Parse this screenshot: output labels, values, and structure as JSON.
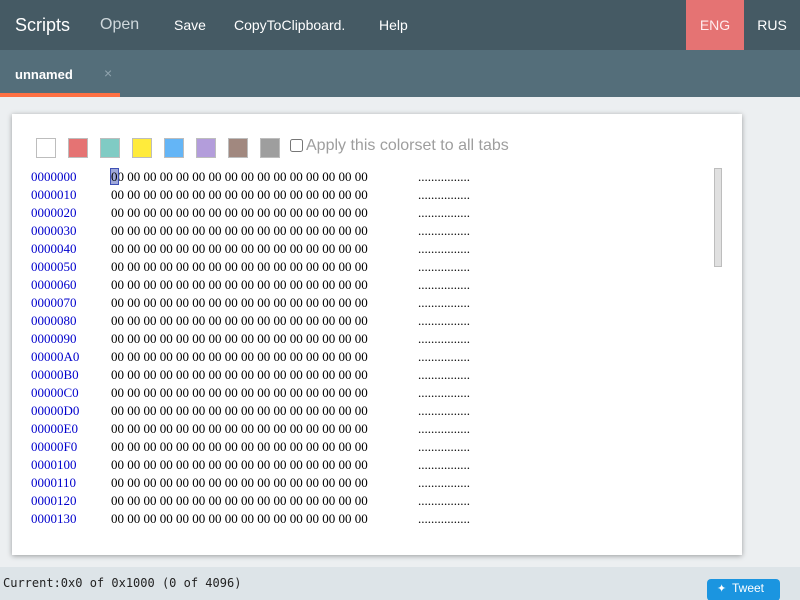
{
  "header": {
    "brand": "Scripts",
    "nav": {
      "open": "Open",
      "save": "Save",
      "copy": "CopyToClipboard.",
      "help": "Help"
    },
    "languages": [
      "ENG",
      "RUS"
    ],
    "active_language": "ENG"
  },
  "tab": {
    "label": "unnamed",
    "close": "×"
  },
  "colorset": {
    "swatches": [
      "#ffffff",
      "#e57373",
      "#80cbc4",
      "#ffeb3b",
      "#64b5f6",
      "#b39ddb",
      "#a1887f",
      "#9e9e9e"
    ],
    "apply_label": "Apply this colorset to all tabs"
  },
  "hex": {
    "rows": [
      {
        "addr": "0000000",
        "bytes": "00 00 00 00 00 00 00 00 00 00 00 00 00 00 00 00",
        "ascii": "................"
      },
      {
        "addr": "0000010",
        "bytes": "00 00 00 00 00 00 00 00 00 00 00 00 00 00 00 00",
        "ascii": "................"
      },
      {
        "addr": "0000020",
        "bytes": "00 00 00 00 00 00 00 00 00 00 00 00 00 00 00 00",
        "ascii": "................"
      },
      {
        "addr": "0000030",
        "bytes": "00 00 00 00 00 00 00 00 00 00 00 00 00 00 00 00",
        "ascii": "................"
      },
      {
        "addr": "0000040",
        "bytes": "00 00 00 00 00 00 00 00 00 00 00 00 00 00 00 00",
        "ascii": "................"
      },
      {
        "addr": "0000050",
        "bytes": "00 00 00 00 00 00 00 00 00 00 00 00 00 00 00 00",
        "ascii": "................"
      },
      {
        "addr": "0000060",
        "bytes": "00 00 00 00 00 00 00 00 00 00 00 00 00 00 00 00",
        "ascii": "................"
      },
      {
        "addr": "0000070",
        "bytes": "00 00 00 00 00 00 00 00 00 00 00 00 00 00 00 00",
        "ascii": "................"
      },
      {
        "addr": "0000080",
        "bytes": "00 00 00 00 00 00 00 00 00 00 00 00 00 00 00 00",
        "ascii": "................"
      },
      {
        "addr": "0000090",
        "bytes": "00 00 00 00 00 00 00 00 00 00 00 00 00 00 00 00",
        "ascii": "................"
      },
      {
        "addr": "00000A0",
        "bytes": "00 00 00 00 00 00 00 00 00 00 00 00 00 00 00 00",
        "ascii": "................"
      },
      {
        "addr": "00000B0",
        "bytes": "00 00 00 00 00 00 00 00 00 00 00 00 00 00 00 00",
        "ascii": "................"
      },
      {
        "addr": "00000C0",
        "bytes": "00 00 00 00 00 00 00 00 00 00 00 00 00 00 00 00",
        "ascii": "................"
      },
      {
        "addr": "00000D0",
        "bytes": "00 00 00 00 00 00 00 00 00 00 00 00 00 00 00 00",
        "ascii": "................"
      },
      {
        "addr": "00000E0",
        "bytes": "00 00 00 00 00 00 00 00 00 00 00 00 00 00 00 00",
        "ascii": "................"
      },
      {
        "addr": "00000F0",
        "bytes": "00 00 00 00 00 00 00 00 00 00 00 00 00 00 00 00",
        "ascii": "................"
      },
      {
        "addr": "0000100",
        "bytes": "00 00 00 00 00 00 00 00 00 00 00 00 00 00 00 00",
        "ascii": "................"
      },
      {
        "addr": "0000110",
        "bytes": "00 00 00 00 00 00 00 00 00 00 00 00 00 00 00 00",
        "ascii": "................"
      },
      {
        "addr": "0000120",
        "bytes": "00 00 00 00 00 00 00 00 00 00 00 00 00 00 00 00",
        "ascii": "................"
      },
      {
        "addr": "0000130",
        "bytes": "00 00 00 00 00 00 00 00 00 00 00 00 00 00 00 00",
        "ascii": "................"
      }
    ]
  },
  "status": {
    "text": "Current:0x0 of 0x1000 (0 of 4096)",
    "tweet_label": "Tweet",
    "tweet_icon": "twitter-bird-icon"
  }
}
